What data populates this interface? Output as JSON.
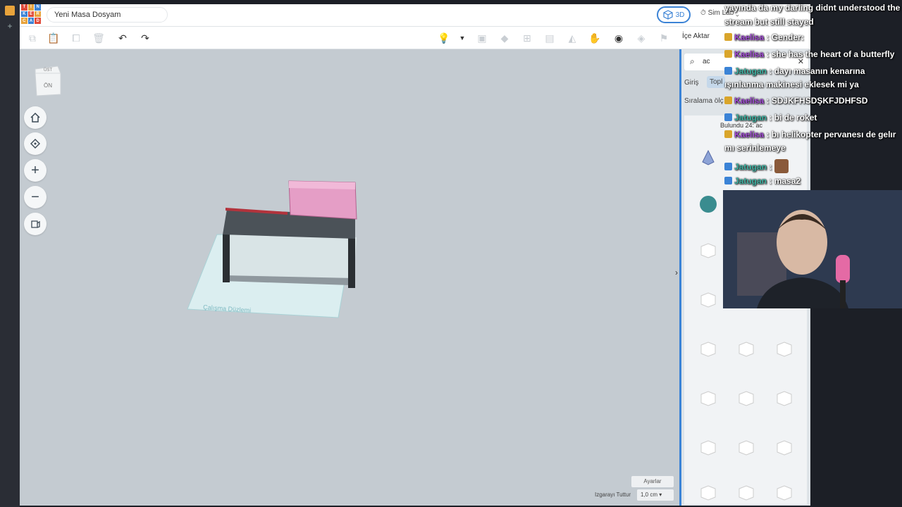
{
  "app": {
    "logo_letters": [
      "T",
      "I",
      "N",
      "K",
      "E",
      "R",
      "C",
      "A",
      "D"
    ],
    "filename": "Yeni Masa Dosyam",
    "mode_3d_label": "3D",
    "simlab_label": "Sim Lab",
    "import_label": "İçe Aktar"
  },
  "toolbar": {
    "icons": [
      "copy-icon",
      "paste-icon",
      "duplicate-icon",
      "delete-icon",
      "undo-icon",
      "redo-icon",
      "light-bulb-icon",
      "dropdown-icon",
      "group-icon",
      "ungroup-icon",
      "align-icon",
      "mirror-icon",
      "cruise-icon",
      "ruler-icon",
      "flip-icon",
      "mirror2-icon"
    ]
  },
  "viewcube": {
    "top_label": "ÜST",
    "front_label": "ÖN"
  },
  "workplane": {
    "label": "Çalışma Düzlemi"
  },
  "canvas_footer": {
    "settings_label": "Ayarlar",
    "grid_snap_label": "Izgarayı Tuttur",
    "grid_snap_value": "1,0 cm"
  },
  "panel": {
    "search_value": "ac",
    "tab_label": "Giriş",
    "tab2_label": "Topl",
    "sort_label": "Sıralama ölç",
    "found_text": "Bulundu 24: ac"
  },
  "chat": {
    "lines": [
      {
        "user": "",
        "text": "yayında da my darling didnt understood the"
      },
      {
        "user": "",
        "text": "stream but still stayed"
      },
      {
        "user": "Kaelisa",
        "text": ": Gender:"
      },
      {
        "user": "Kaelisa",
        "text": ": she has the heart of a butterfly"
      },
      {
        "user": "Jatugan",
        "text": ": dayı masanın kenarına"
      },
      {
        "user": "",
        "text": "ışınlanma makinesi eklesek mi ya"
      },
      {
        "user": "Kaelisa",
        "text": ": SDJKFHSDŞKFJDHFSD"
      },
      {
        "user": "Jatugan",
        "text": ": bi de roket"
      },
      {
        "user": "Kaelisa",
        "text": ": bı helikopter pervanesı de gelır"
      },
      {
        "user": "",
        "text": "mı serinlemeye"
      },
      {
        "user": "Jatugan",
        "text": ":"
      },
      {
        "user": "Jatugan",
        "text": ": masa2"
      }
    ]
  },
  "colors": {
    "accent": "#3b83d6",
    "canvas": "#c4cbd1",
    "desk_top": "#4b5258",
    "monitor": "#e59ec6"
  }
}
